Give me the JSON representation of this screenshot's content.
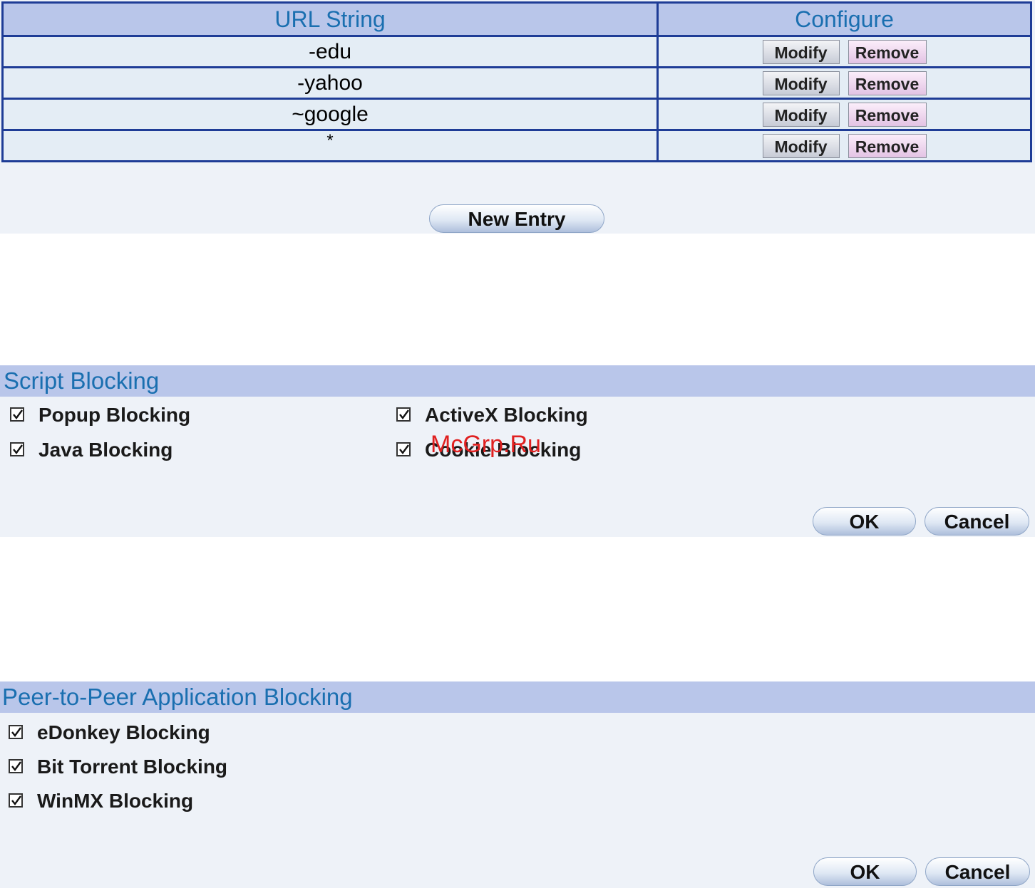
{
  "url_table": {
    "headers": {
      "url_string": "URL String",
      "configure": "Configure"
    },
    "rows": [
      {
        "url": "-edu",
        "modify_label": "Modify",
        "remove_label": "Remove"
      },
      {
        "url": "-yahoo",
        "modify_label": "Modify",
        "remove_label": "Remove"
      },
      {
        "url": "~google",
        "modify_label": "Modify",
        "remove_label": "Remove"
      },
      {
        "url": "*",
        "modify_label": "Modify",
        "remove_label": "Remove"
      }
    ],
    "new_entry_label": "New Entry"
  },
  "script_blocking": {
    "title": "Script Blocking",
    "options": [
      {
        "label": "Popup Blocking",
        "checked": true
      },
      {
        "label": "ActiveX Blocking",
        "checked": true
      },
      {
        "label": "Java Blocking",
        "checked": true
      },
      {
        "label": "Cookie Blocking",
        "checked": true
      }
    ],
    "ok_label": "OK",
    "cancel_label": "Cancel"
  },
  "p2p_blocking": {
    "title": "Peer-to-Peer Application Blocking",
    "options": [
      {
        "label": "eDonkey Blocking",
        "checked": true
      },
      {
        "label": "Bit Torrent Blocking",
        "checked": true
      },
      {
        "label": "WinMX Blocking",
        "checked": true
      }
    ],
    "ok_label": "OK",
    "cancel_label": "Cancel"
  },
  "watermark": "McGrp.Ru",
  "colors": {
    "header_bg": "#b9c6ea",
    "header_text": "#1a6fb0",
    "table_border": "#1e3c96",
    "panel_bg": "#eef2f8",
    "watermark": "#e02020"
  }
}
